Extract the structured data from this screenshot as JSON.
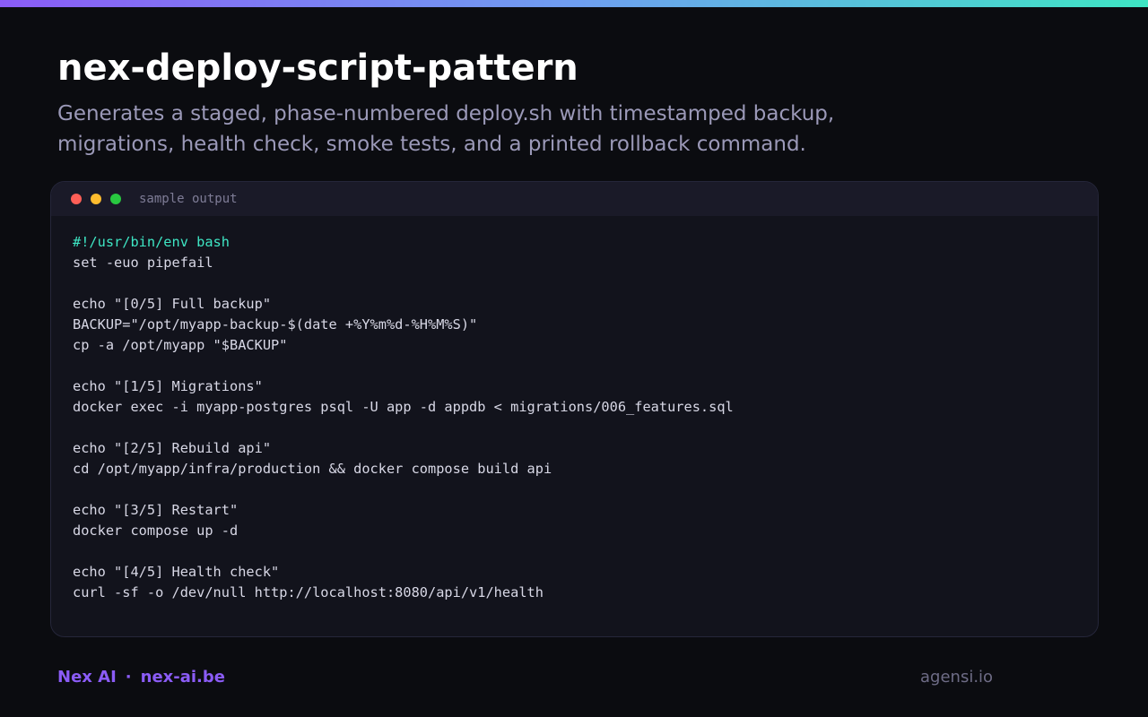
{
  "page": {
    "title": "nex-deploy-script-pattern",
    "subtitle_lines": [
      "Generates a staged, phase-numbered deploy.sh with timestamped backup,",
      "migrations, health check, smoke tests, and a printed rollback command."
    ]
  },
  "terminal": {
    "label": "sample output",
    "lines": [
      "#!/usr/bin/env bash",
      "set -euo pipefail",
      "",
      "echo \"[0/5] Full backup\"",
      "BACKUP=\"/opt/myapp-backup-$(date +%Y%m%d-%H%M%S)\"",
      "cp -a /opt/myapp \"$BACKUP\"",
      "",
      "echo \"[1/5] Migrations\"",
      "docker exec -i myapp-postgres psql -U app -d appdb < migrations/006_features.sql",
      "",
      "echo \"[2/5] Rebuild api\"",
      "cd /opt/myapp/infra/production && docker compose build api",
      "",
      "echo \"[3/5] Restart\"",
      "docker compose up -d",
      "",
      "echo \"[4/5] Health check\"",
      "curl -sf -o /dev/null http://localhost:8080/api/v1/health"
    ]
  },
  "footer": {
    "brand": "Nex AI",
    "separator": "·",
    "site": "nex-ai.be",
    "credit": "agensi.io"
  },
  "colors": {
    "accent": "#8b5cf6",
    "shebang": "#3ee6c4",
    "background": "#0b0c10"
  }
}
